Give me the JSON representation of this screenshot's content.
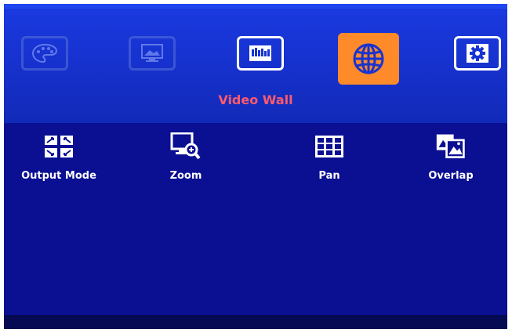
{
  "menu": {
    "title": "Video Wall",
    "top_icons": [
      {
        "icon": "palette-icon",
        "state": "dim"
      },
      {
        "icon": "display-picture-icon",
        "state": "dim"
      },
      {
        "icon": "video-wall-icon",
        "state": "bright"
      },
      {
        "icon": "globe-icon",
        "state": "selected"
      },
      {
        "icon": "gear-icon",
        "state": "bright"
      }
    ],
    "items": [
      {
        "icon": "output-mode-icon",
        "label": "Output Mode"
      },
      {
        "icon": "zoom-icon",
        "label": "Zoom"
      },
      {
        "icon": "pan-icon",
        "label": "Pan"
      },
      {
        "icon": "overlap-icon",
        "label": "Overlap"
      }
    ]
  },
  "colors": {
    "top_band": "#1733d2",
    "panel": "#0b0f92",
    "accent_selected": "#ff8a2a",
    "title": "#ff5a6a"
  }
}
